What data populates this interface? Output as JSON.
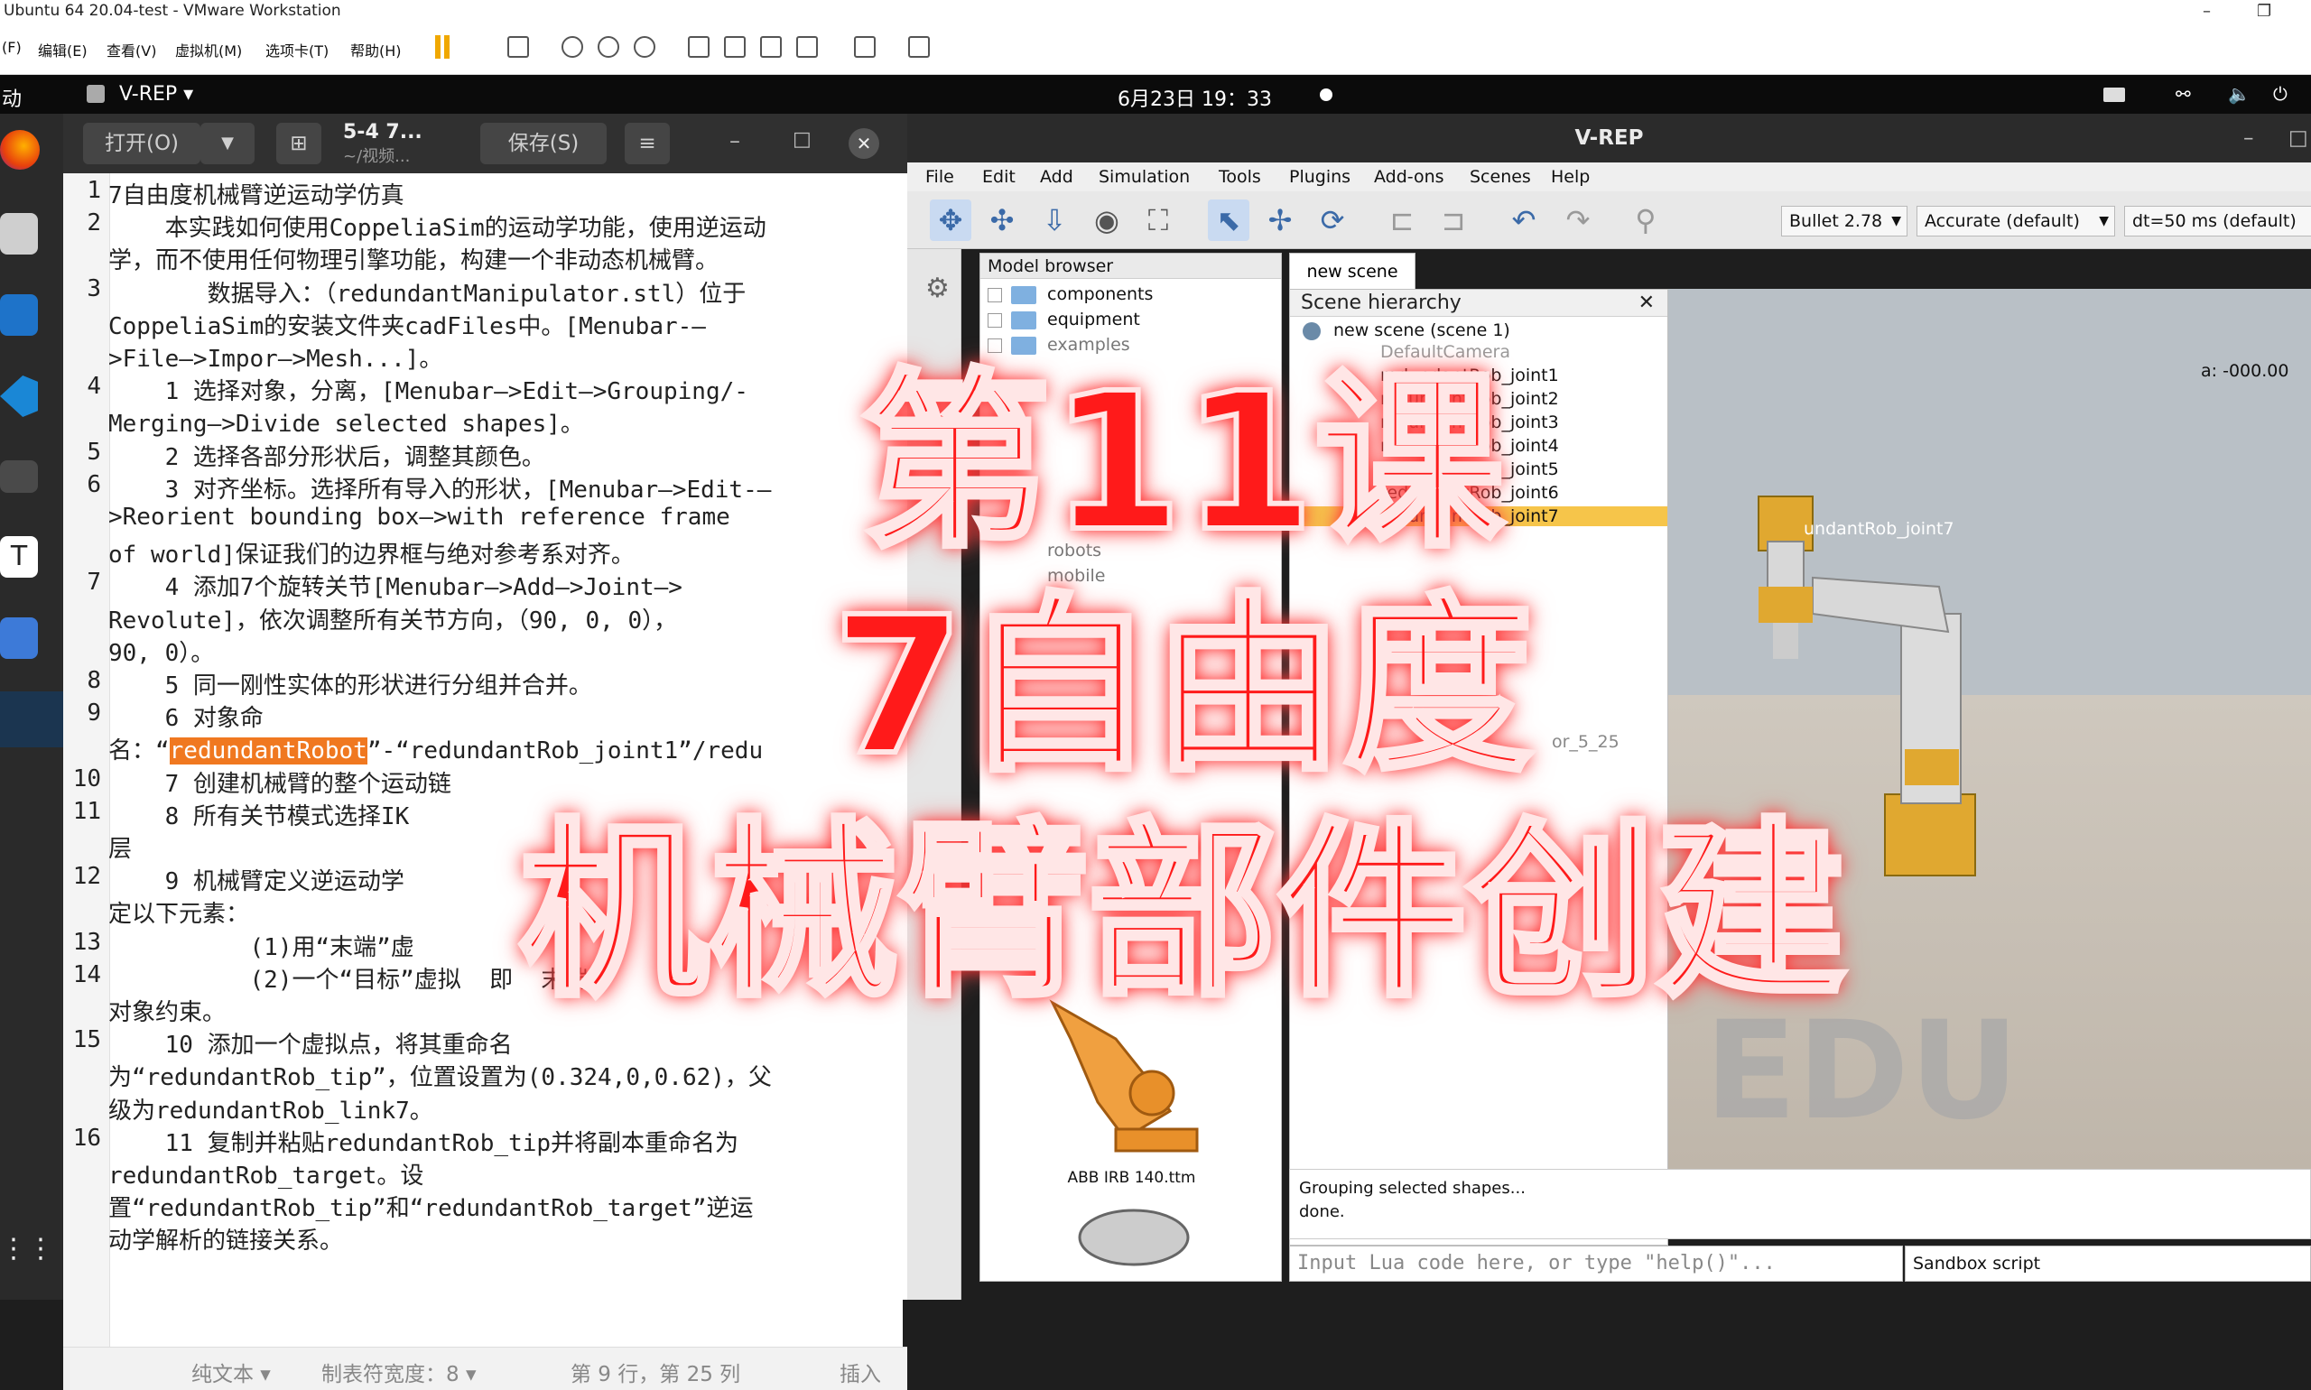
{
  "vm": {
    "title": "Ubuntu 64 20.04-test - VMware Workstation",
    "menu": [
      "(F)",
      "编辑(E)",
      "查看(V)",
      "虚拟机(M)",
      "选项卡(T)",
      "帮助(H)"
    ]
  },
  "topbar": {
    "activities": "动",
    "app_name": "V-REP ▾",
    "datetime": "6月23日 19：33"
  },
  "gedit": {
    "open_label": "打开(O)",
    "doc_title": "5-4 7...",
    "doc_path": "~/视频...",
    "save_label": "保存(S)",
    "lines": [
      {
        "n": "1",
        "text": "7自由度机械臂逆运动学仿真"
      },
      {
        "n": "2",
        "text": "    本实践如何使用CoppeliaSim的运动学功能，使用逆运动"
      },
      {
        "n": "",
        "text": "学，而不使用任何物理引擎功能，构建一个非动态机械臂。"
      },
      {
        "n": "3",
        "text": "       数据导入：（redundantManipulator.stl）位于"
      },
      {
        "n": "",
        "text": "CoppeliaSim的安装文件夹cadFiles中。[Menubar-–"
      },
      {
        "n": "",
        "text": ">File–>Impor–>Mesh...]。"
      },
      {
        "n": "4",
        "text": "    1 选择对象，分离，[Menubar–>Edit–>Grouping/-"
      },
      {
        "n": "",
        "text": "Merging–>Divide selected shapes]。"
      },
      {
        "n": "5",
        "text": "    2 选择各部分形状后，调整其颜色。"
      },
      {
        "n": "6",
        "text": "    3 对齐坐标。选择所有导入的形状，[Menubar–>Edit-–"
      },
      {
        "n": "",
        "text": ">Reorient bounding box–>with reference frame"
      },
      {
        "n": "",
        "text": "of world]保证我们的边界框与绝对参考系对齐。"
      },
      {
        "n": "7",
        "text": "    4 添加7个旋转关节[Menubar–>Add–>Joint–>"
      },
      {
        "n": "",
        "text": "Revolute]，依次调整所有关节方向，（90, 0, 0），"
      },
      {
        "n": "",
        "text": "90, 0）。"
      },
      {
        "n": "8",
        "text": "    5 同一刚性实体的形状进行分组并合并。"
      },
      {
        "n": "9",
        "text": "    6 对象命"
      },
      {
        "n": "",
        "text": "名：“redundantRobot”-“redundantRob_joint1”/redu"
      },
      {
        "n": "10",
        "text": "    7 创建机械臂的整个运动链"
      },
      {
        "n": "11",
        "text": "    8 所有关节模式选择IK"
      },
      {
        "n": "",
        "text": "层"
      },
      {
        "n": "12",
        "text": "    9 机械臂定义逆运动学"
      },
      {
        "n": "",
        "text": "定以下元素："
      },
      {
        "n": "13",
        "text": "          (1)用“末端”虚"
      },
      {
        "n": "14",
        "text": "          (2)一个“目标”虚拟  即  末端“    个"
      },
      {
        "n": "",
        "text": "对象约束。"
      },
      {
        "n": "15",
        "text": "    10 添加一个虚拟点，将其重命名"
      },
      {
        "n": "",
        "text": "为“redundantRob_tip”，位置设置为(0.324,0,0.62)，父"
      },
      {
        "n": "",
        "text": "级为redundantRob_link7。"
      },
      {
        "n": "16",
        "text": "    11 复制并粘贴redundantRob_tip并将副本重命名为"
      },
      {
        "n": "",
        "text": "redundantRob_target。设"
      },
      {
        "n": "",
        "text": "置“redundantRob_tip”和“redundantRob_target”逆运"
      },
      {
        "n": "",
        "text": "动学解析的链接关系。"
      }
    ],
    "highlight": "redundantRobot",
    "status": {
      "mode": "纯文本 ▾",
      "tab_width": "制表符宽度：8 ▾",
      "position": "第 9 行，第 25 列",
      "insert": "插入"
    }
  },
  "vrep": {
    "title": "V-REP",
    "menu": [
      "File",
      "Edit",
      "Add",
      "Simulation",
      "Tools",
      "Plugins",
      "Add-ons",
      "Scenes",
      "Help"
    ],
    "engine": "Bullet 2.78",
    "accuracy": "Accurate (default)",
    "timestep": "dt=50 ms (default)",
    "model_browser": {
      "title": "Model browser",
      "items": [
        "components",
        "equipment",
        "examples",
        "robots",
        "mobile"
      ]
    },
    "thumbnail_label": "ABB IRB 140.ttm",
    "scene_tab": "new scene",
    "hierarchy": {
      "title": "Scene hierarchy",
      "root": "new scene (scene 1)",
      "items": [
        "DefaultCamera",
        "redundantRob_joint1",
        "redundantRob_joint2",
        "redundantRob_joint3",
        "redundantRob_joint4",
        "redundantRob_joint5",
        "redundantRob_joint6",
        "redundantRob_joint7"
      ],
      "selected": "redundantRob_joint7",
      "extra": "or_5_25"
    },
    "viewport": {
      "coord": "a: -000.00",
      "label": "undantRob_joint7",
      "watermark": "EDU"
    },
    "output": [
      "Grouping selected shapes...",
      "done."
    ],
    "lua_placeholder": "Input Lua code here, or type \"help()\"...",
    "sandbox": "Sandbox script"
  },
  "overlay": {
    "line1": "第11课",
    "line2": "7自由度",
    "line3": "机械臂部件创建"
  }
}
